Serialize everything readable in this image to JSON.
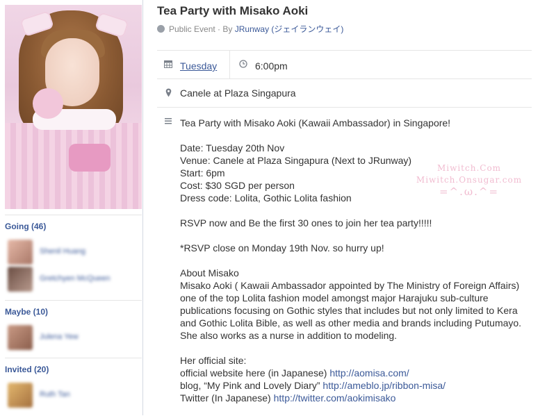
{
  "sidebar": {
    "going": {
      "label": "Going (46)",
      "members": [
        {
          "name": "Shenil Huang",
          "color": "#c89b8f"
        },
        {
          "name": "Gretchyen McQueen",
          "color": "#8c6a5a"
        }
      ]
    },
    "maybe": {
      "label": "Maybe (10)",
      "members": [
        {
          "name": "Julena Yew",
          "color": "#b07e6a"
        }
      ]
    },
    "invited": {
      "label": "Invited (20)",
      "members": [
        {
          "name": "Ruth Tan",
          "color": "#d1a063"
        }
      ]
    }
  },
  "event": {
    "title": "Tea Party with Misako Aoki",
    "visibility": "Public Event",
    "by_prefix": "· By",
    "host": "JRunway (ジェイランウェイ)",
    "day": "Tuesday",
    "time": "6:00pm",
    "location": "Canele at Plaza Singapura",
    "description": {
      "intro": "Tea Party with Misako Aoki (Kawaii Ambassador) in Singapore!",
      "date": "Date: Tuesday 20th Nov",
      "venue": "Venue: Canele at Plaza Singapura (Next to JRunway)",
      "start": "Start: 6pm",
      "cost": "Cost: $30 SGD per person",
      "dress_code": "Dress code: Lolita, Gothic Lolita fashion",
      "rsvp": "RSVP now and Be the first 30 ones to join her tea party!!!!!",
      "rsvp_close": "*RSVP close on Monday 19th Nov. so hurry up!",
      "about_heading": "About Misako",
      "about_text": "Misako Aoki ( Kawaii Ambassador appointed by The Ministry of Foreign Affairs) one of the top Lolita fashion model amongst major Harajuku sub-culture publications focusing on Gothic styles that includes but not only limited to Kera and Gothic Lolita Bible, as well as other media and brands including Putumayo. She also works as a nurse in addition to modeling.",
      "site_heading": "Her official site:",
      "links": [
        {
          "prefix": "official website here (in Japanese)",
          "url": "http://aomisa.com/"
        },
        {
          "prefix": "blog, “My Pink and Lovely Diary”",
          "url": "http://ameblo.jp/ribbon-misa/"
        },
        {
          "prefix": "Twitter (In Japanese)",
          "url": "http://twitter.com/aokimisako"
        }
      ]
    }
  },
  "watermark": {
    "line1": "Miwitch.Com",
    "line2": "Miwitch.Onsugar.com",
    "face": "=^.ω.^="
  },
  "colors": {
    "link": "#3b5998",
    "text": "#333333",
    "watermark": "#f1bcd0"
  },
  "icons": [
    "globe-icon",
    "calendar-icon",
    "clock-icon",
    "location-pin-icon",
    "description-icon"
  ]
}
